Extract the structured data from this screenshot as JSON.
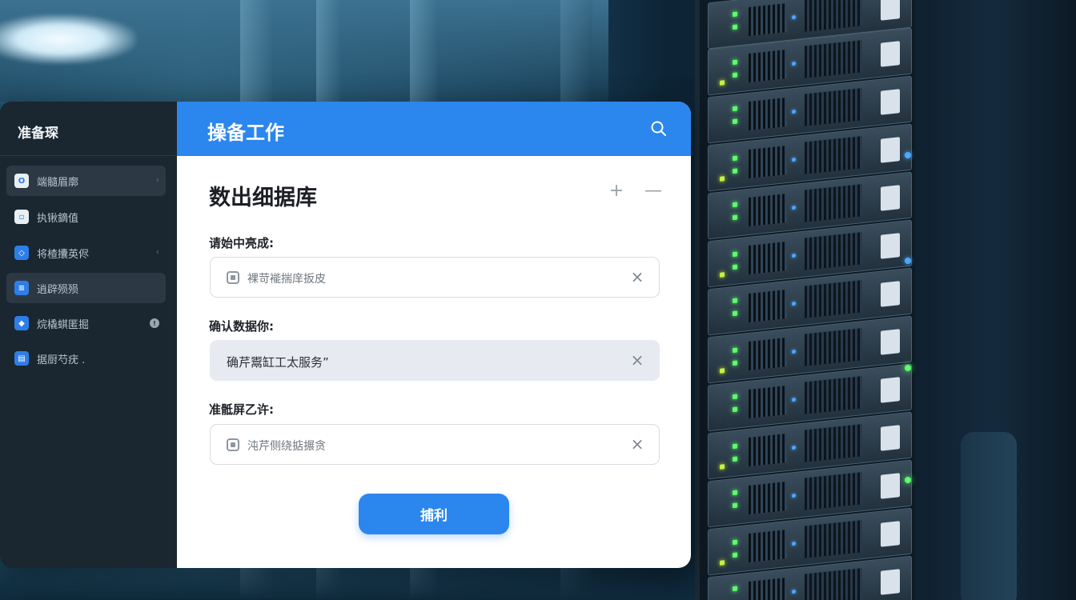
{
  "sidebar": {
    "title": "准备琛",
    "items": [
      {
        "label": "端髓眉廓",
        "icon": "circle-icon",
        "trail": "‹",
        "active": true
      },
      {
        "label": "执锹鏑值",
        "icon": "square-icon",
        "trail": "",
        "active": false
      },
      {
        "label": "将楂攮英侭",
        "icon": "shield-icon",
        "trail": "‹",
        "active": false
      },
      {
        "label": "逍辟殒殒",
        "icon": "document-icon",
        "trail": "",
        "active": true
      },
      {
        "label": "烷橇蜞匿掘",
        "icon": "diamond-icon",
        "trail": "",
        "badge": "!",
        "active": false
      },
      {
        "label": "据厨芍疣 .",
        "icon": "document-icon",
        "trail": "",
        "active": false
      }
    ]
  },
  "header": {
    "title": "操备工作",
    "search_icon": "search-icon"
  },
  "content": {
    "section_title": "数出细据库",
    "add_symbol": "+",
    "minimize_symbol": "—",
    "fields": [
      {
        "label": "请始中亮成:",
        "placeholder": "裸苛褦揣庠扳皮",
        "value": "",
        "clear": "×"
      },
      {
        "label": "确认数据你:",
        "placeholder": "",
        "value": "确芹鬻缸工太服务”",
        "clear": "×"
      },
      {
        "label": "准骶屏乙许:",
        "placeholder": "沌芹侧绕掂搌贪",
        "value": "",
        "clear": "×"
      }
    ],
    "submit_label": "捕利"
  },
  "colors": {
    "accent": "#2b86ee",
    "sidebar_bg": "#1a2630",
    "led_green": "#5cff6b"
  }
}
